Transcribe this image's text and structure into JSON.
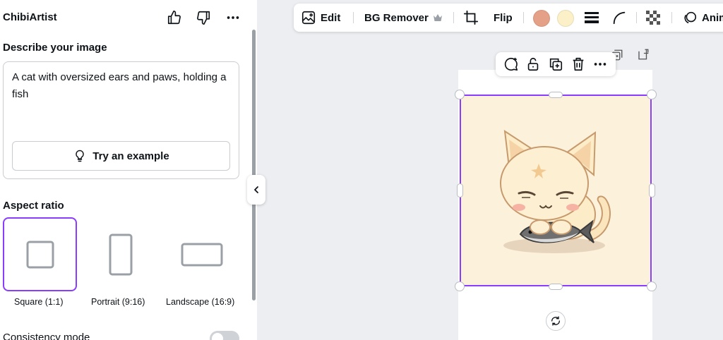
{
  "panel": {
    "app_title": "ChibiArtist",
    "describe_label": "Describe your image",
    "prompt_text": "A cat with oversized ears and paws, holding a fish",
    "try_example_label": "Try an example",
    "aspect_label": "Aspect ratio",
    "ratios": [
      {
        "label": "Square (1:1)",
        "icon": "square-ratio-icon",
        "selected": true
      },
      {
        "label": "Portrait (9:16)",
        "icon": "portrait-ratio-icon",
        "selected": false
      },
      {
        "label": "Landscape (16:9)",
        "icon": "landscape-ratio-icon",
        "selected": false
      }
    ],
    "consistency_label": "Consistency mode",
    "consistency_enabled": false
  },
  "toolbar": {
    "edit_label": "Edit",
    "bg_remover_label": "BG Remover",
    "flip_label": "Flip",
    "animate_label": "Animate",
    "swatches": [
      "#e5a088",
      "#fbf0c8"
    ]
  },
  "colors": {
    "accent": "#8b3dff",
    "image_background": "#fcf2dc"
  },
  "canvas": {
    "image_subject": "chibi-cat-holding-fish-illustration"
  }
}
